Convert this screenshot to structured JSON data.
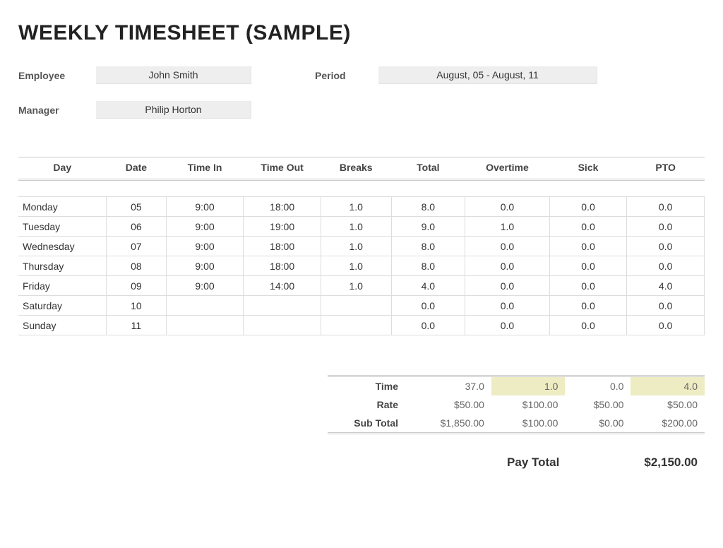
{
  "title": "WEEKLY TIMESHEET (SAMPLE)",
  "header": {
    "employee_label": "Employee",
    "employee_value": "John Smith",
    "period_label": "Period",
    "period_value": "August, 05 - August, 11",
    "manager_label": "Manager",
    "manager_value": "Philip Horton"
  },
  "columns": {
    "day": "Day",
    "date": "Date",
    "time_in": "Time In",
    "time_out": "Time Out",
    "breaks": "Breaks",
    "total": "Total",
    "overtime": "Overtime",
    "sick": "Sick",
    "pto": "PTO"
  },
  "rows": [
    {
      "day": "Monday",
      "date": "05",
      "in": "9:00",
      "out": "18:00",
      "breaks": "1.0",
      "total": "8.0",
      "ot": "0.0",
      "sick": "0.0",
      "pto": "0.0"
    },
    {
      "day": "Tuesday",
      "date": "06",
      "in": "9:00",
      "out": "19:00",
      "breaks": "1.0",
      "total": "9.0",
      "ot": "1.0",
      "sick": "0.0",
      "pto": "0.0"
    },
    {
      "day": "Wednesday",
      "date": "07",
      "in": "9:00",
      "out": "18:00",
      "breaks": "1.0",
      "total": "8.0",
      "ot": "0.0",
      "sick": "0.0",
      "pto": "0.0"
    },
    {
      "day": "Thursday",
      "date": "08",
      "in": "9:00",
      "out": "18:00",
      "breaks": "1.0",
      "total": "8.0",
      "ot": "0.0",
      "sick": "0.0",
      "pto": "0.0"
    },
    {
      "day": "Friday",
      "date": "09",
      "in": "9:00",
      "out": "14:00",
      "breaks": "1.0",
      "total": "4.0",
      "ot": "0.0",
      "sick": "0.0",
      "pto": "4.0"
    },
    {
      "day": "Saturday",
      "date": "10",
      "in": "",
      "out": "",
      "breaks": "",
      "total": "0.0",
      "ot": "0.0",
      "sick": "0.0",
      "pto": "0.0"
    },
    {
      "day": "Sunday",
      "date": "11",
      "in": "",
      "out": "",
      "breaks": "",
      "total": "0.0",
      "ot": "0.0",
      "sick": "0.0",
      "pto": "0.0"
    }
  ],
  "summary": {
    "labels": {
      "time": "Time",
      "rate": "Rate",
      "subtotal": "Sub Total"
    },
    "time": {
      "total": "37.0",
      "ot": "1.0",
      "sick": "0.0",
      "pto": "4.0"
    },
    "rate": {
      "total": "$50.00",
      "ot": "$100.00",
      "sick": "$50.00",
      "pto": "$50.00"
    },
    "subtotal": {
      "total": "$1,850.00",
      "ot": "$100.00",
      "sick": "$0.00",
      "pto": "$200.00"
    }
  },
  "paytotal": {
    "label": "Pay Total",
    "value": "$2,150.00"
  }
}
